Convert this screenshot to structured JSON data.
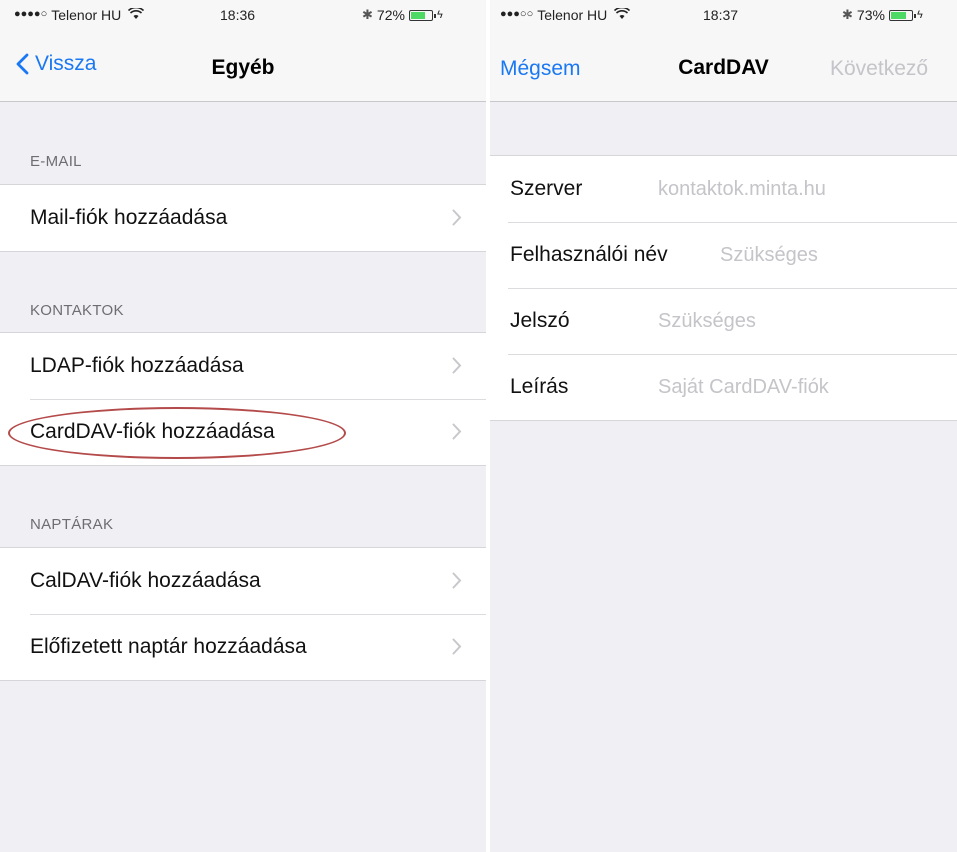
{
  "left": {
    "status": {
      "carrier": "Telenor HU",
      "time": "18:36",
      "battery": "72%",
      "battery_level": 0.72
    },
    "nav": {
      "back_label": "Vissza",
      "title": "Egyéb"
    },
    "sections": [
      {
        "header": "E-MAIL",
        "items": [
          "Mail-fiók hozzáadása"
        ]
      },
      {
        "header": "KONTAKTOK",
        "items": [
          "LDAP-fiók hozzáadása",
          "CardDAV-fiók hozzáadása"
        ]
      },
      {
        "header": "NAPTÁRAK",
        "items": [
          "CalDAV-fiók hozzáadása",
          "Előfizetett naptár hozzáadása"
        ]
      }
    ]
  },
  "right": {
    "status": {
      "carrier": "Telenor HU",
      "time": "18:37",
      "battery": "73%",
      "battery_level": 0.73
    },
    "nav": {
      "cancel_label": "Mégsem",
      "title": "CardDAV",
      "next_label": "Következő"
    },
    "fields": [
      {
        "label": "Szerver",
        "placeholder": "kontaktok.minta.hu"
      },
      {
        "label": "Felhasználói név",
        "placeholder": "Szükséges"
      },
      {
        "label": "Jelszó",
        "placeholder": "Szükséges"
      },
      {
        "label": "Leírás",
        "placeholder": "Saját CardDAV-fiók"
      }
    ]
  },
  "colors": {
    "accent": "#1a78f2",
    "disabled": "#c4c4c9",
    "highlight": "#b44a4a",
    "background": "#efeff4"
  }
}
